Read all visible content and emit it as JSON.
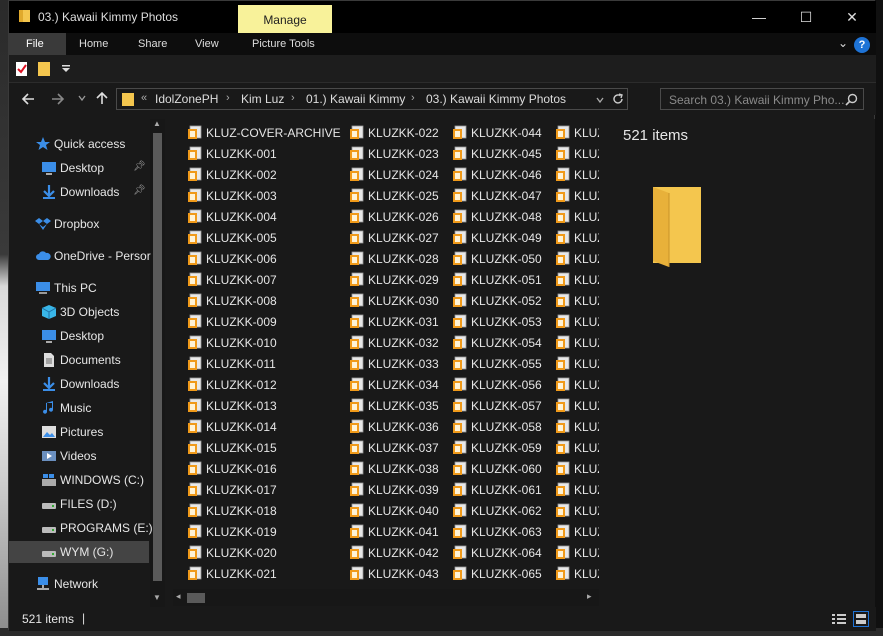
{
  "window": {
    "title": "03.) Kawaii Kimmy Photos",
    "manage_label": "Manage",
    "minimize": "—",
    "maximize": "☐",
    "close": "✕"
  },
  "ribbon": {
    "tabs": [
      "File",
      "Home",
      "Share",
      "View",
      "Picture Tools"
    ],
    "help_label": "?",
    "collapse_label": "⌄"
  },
  "address": {
    "overflow": "«",
    "crumbs": [
      "IdolZonePH",
      "Kim Luz",
      "01.) Kawaii Kimmy",
      "03.) Kawaii Kimmy Photos"
    ],
    "search_placeholder": "Search 03.) Kawaii Kimmy Pho..."
  },
  "nav": {
    "items": [
      {
        "label": "Quick access",
        "icon": "star-icon"
      },
      {
        "label": "Desktop",
        "icon": "desktop-icon",
        "pinned": true
      },
      {
        "label": "Downloads",
        "icon": "download-icon",
        "pinned": true
      },
      {
        "label": "Dropbox",
        "icon": "dropbox-icon"
      },
      {
        "label": "OneDrive - Persor",
        "icon": "cloud-icon"
      },
      {
        "label": "This PC",
        "icon": "pc-icon"
      },
      {
        "label": "3D Objects",
        "icon": "cube-icon"
      },
      {
        "label": "Desktop",
        "icon": "desktop-icon"
      },
      {
        "label": "Documents",
        "icon": "document-icon"
      },
      {
        "label": "Downloads",
        "icon": "download-icon"
      },
      {
        "label": "Music",
        "icon": "music-icon"
      },
      {
        "label": "Pictures",
        "icon": "pictures-icon"
      },
      {
        "label": "Videos",
        "icon": "video-icon"
      },
      {
        "label": "WINDOWS (C:)",
        "icon": "windows-drive-icon"
      },
      {
        "label": "FILES (D:)",
        "icon": "drive-icon"
      },
      {
        "label": "PROGRAMS (E:)",
        "icon": "drive-icon"
      },
      {
        "label": "WYM (G:)",
        "icon": "drive-icon",
        "selected": true
      },
      {
        "label": "Network",
        "icon": "network-icon"
      }
    ]
  },
  "files": {
    "columns": [
      [
        "KLUZ-COVER-ARCHIVE",
        "KLUZKK-001",
        "KLUZKK-002",
        "KLUZKK-003",
        "KLUZKK-004",
        "KLUZKK-005",
        "KLUZKK-006",
        "KLUZKK-007",
        "KLUZKK-008",
        "KLUZKK-009",
        "KLUZKK-010",
        "KLUZKK-011",
        "KLUZKK-012",
        "KLUZKK-013",
        "KLUZKK-014",
        "KLUZKK-015",
        "KLUZKK-016",
        "KLUZKK-017",
        "KLUZKK-018",
        "KLUZKK-019",
        "KLUZKK-020",
        "KLUZKK-021"
      ],
      [
        "KLUZKK-022",
        "KLUZKK-023",
        "KLUZKK-024",
        "KLUZKK-025",
        "KLUZKK-026",
        "KLUZKK-027",
        "KLUZKK-028",
        "KLUZKK-029",
        "KLUZKK-030",
        "KLUZKK-031",
        "KLUZKK-032",
        "KLUZKK-033",
        "KLUZKK-034",
        "KLUZKK-035",
        "KLUZKK-036",
        "KLUZKK-037",
        "KLUZKK-038",
        "KLUZKK-039",
        "KLUZKK-040",
        "KLUZKK-041",
        "KLUZKK-042",
        "KLUZKK-043"
      ],
      [
        "KLUZKK-044",
        "KLUZKK-045",
        "KLUZKK-046",
        "KLUZKK-047",
        "KLUZKK-048",
        "KLUZKK-049",
        "KLUZKK-050",
        "KLUZKK-051",
        "KLUZKK-052",
        "KLUZKK-053",
        "KLUZKK-054",
        "KLUZKK-055",
        "KLUZKK-056",
        "KLUZKK-057",
        "KLUZKK-058",
        "KLUZKK-059",
        "KLUZKK-060",
        "KLUZKK-061",
        "KLUZKK-062",
        "KLUZKK-063",
        "KLUZKK-064",
        "KLUZKK-065"
      ],
      [
        "KLUZ",
        "KLUZ",
        "KLUZ",
        "KLUZ",
        "KLUZ",
        "KLUZ",
        "KLUZ",
        "KLUZ",
        "KLUZ",
        "KLUZ",
        "KLUZ",
        "KLUZ",
        "KLUZ",
        "KLUZ",
        "KLUZ",
        "KLUZ",
        "KLUZ",
        "KLUZ",
        "KLUZ",
        "KLUZ",
        "KLUZ",
        "KLUZ"
      ]
    ]
  },
  "preview": {
    "item_count": "521 items"
  },
  "status": {
    "text": "521 items",
    "cursor": "|"
  },
  "colors": {
    "manage_tab": "#f8f29a",
    "folder": "#f4c64e",
    "accent": "#1e73d6"
  }
}
